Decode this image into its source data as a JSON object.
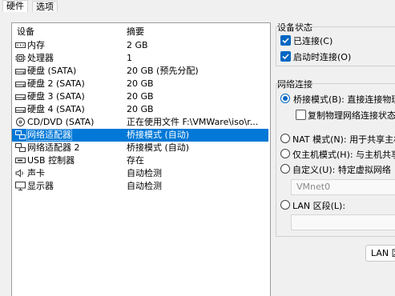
{
  "tabs": [
    {
      "label": "硬件"
    },
    {
      "label": "选项"
    }
  ],
  "device_list": {
    "headers": {
      "device": "设备",
      "summary": "摘要"
    },
    "rows": [
      {
        "device": "内存",
        "summary": "2 GB",
        "icon": "memory-icon"
      },
      {
        "device": "处理器",
        "summary": "1",
        "icon": "cpu-icon"
      },
      {
        "device": "硬盘 (SATA)",
        "summary": "20 GB (预先分配)",
        "icon": "disk-icon"
      },
      {
        "device": "硬盘 2 (SATA)",
        "summary": "20 GB",
        "icon": "disk-icon"
      },
      {
        "device": "硬盘 3 (SATA)",
        "summary": "20 GB",
        "icon": "disk-icon"
      },
      {
        "device": "硬盘 4 (SATA)",
        "summary": "20 GB",
        "icon": "disk-icon"
      },
      {
        "device": "CD/DVD (SATA)",
        "summary": "正在使用文件 F:\\VMWare\\iso\\r...",
        "icon": "cd-icon"
      },
      {
        "device": "网络适配器",
        "summary": "桥接模式 (自动)",
        "icon": "network-icon",
        "selected": true
      },
      {
        "device": "网络适配器 2",
        "summary": "桥接模式 (自动)",
        "icon": "network-icon"
      },
      {
        "device": "USB 控制器",
        "summary": "存在",
        "icon": "usb-icon"
      },
      {
        "device": "声卡",
        "summary": "自动检测",
        "icon": "speaker-icon"
      },
      {
        "device": "显示器",
        "summary": "自动检测",
        "icon": "monitor-icon"
      }
    ]
  },
  "device_status": {
    "title": "设备状态",
    "connected": {
      "label": "已连接(C)",
      "checked": true
    },
    "connect_on_power": {
      "label": "启动时连接(O)",
      "checked": true
    }
  },
  "network_connection": {
    "title": "网络连接",
    "bridged": {
      "label": "桥接模式(B): 直接连接物理",
      "selected": true
    },
    "replicate": {
      "label": "复制物理网络连接状态(",
      "checked": false
    },
    "nat": {
      "label": "NAT 模式(N): 用于共享主机",
      "selected": false
    },
    "host_only": {
      "label": "仅主机模式(H): 与主机共享",
      "selected": false
    },
    "custom": {
      "label": "自定义(U): 特定虚拟网络",
      "selected": false
    },
    "custom_value": "VMnet0",
    "lan_segment": {
      "label": "LAN 区段(L):",
      "selected": false
    },
    "lan_button": "LAN 区"
  },
  "colors": {
    "selection": "#0078d7",
    "accent": "#0067c0"
  }
}
